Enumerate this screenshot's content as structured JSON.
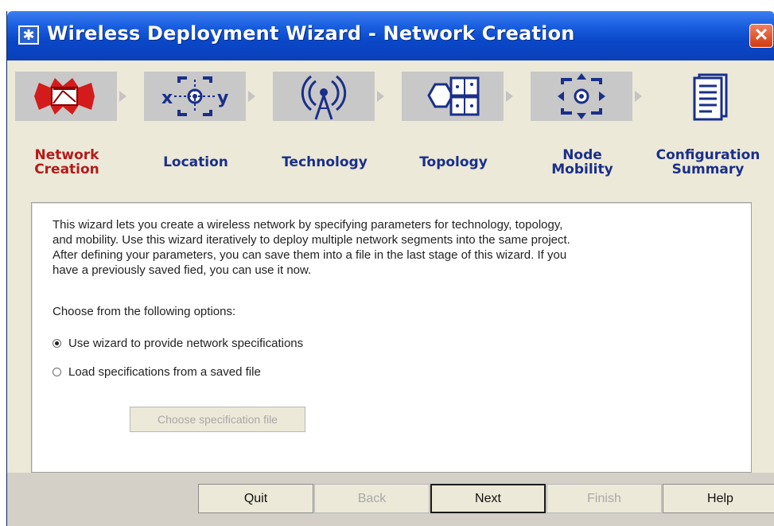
{
  "window": {
    "title": "Wireless Deployment Wizard - Network Creation"
  },
  "steps": [
    {
      "label_line1": "Network",
      "label_line2": "Creation"
    },
    {
      "label_line1": "Location",
      "label_line2": ""
    },
    {
      "label_line1": "Technology",
      "label_line2": ""
    },
    {
      "label_line1": "Topology",
      "label_line2": ""
    },
    {
      "label_line1": "Node",
      "label_line2": "Mobility"
    },
    {
      "label_line1": "Configuration",
      "label_line2": "Summary"
    }
  ],
  "content": {
    "intro_line1": "This wizard lets you create a wireless network by specifying parameters for technology, topology,",
    "intro_line2": "and mobility. Use this wizard iteratively to deploy multiple network segments into the same project.",
    "intro_line3": "After defining your parameters, you can save them into a file in the last stage of this wizard. If you",
    "intro_line4": "have a previously saved fied, you can use it now.",
    "prompt": "Choose from the following options:",
    "option_wizard": "Use wizard to provide network specifications",
    "option_load": "Load specifications from a saved file",
    "choose_file_button": "Choose specification file",
    "selected_option": "wizard"
  },
  "buttons": {
    "quit": "Quit",
    "back": "Back",
    "next": "Next",
    "finish": "Finish",
    "help": "Help"
  },
  "colors": {
    "active_step": "#b31b1b",
    "step_label": "#1a2f8a",
    "titlebar": "#0a48c8"
  }
}
